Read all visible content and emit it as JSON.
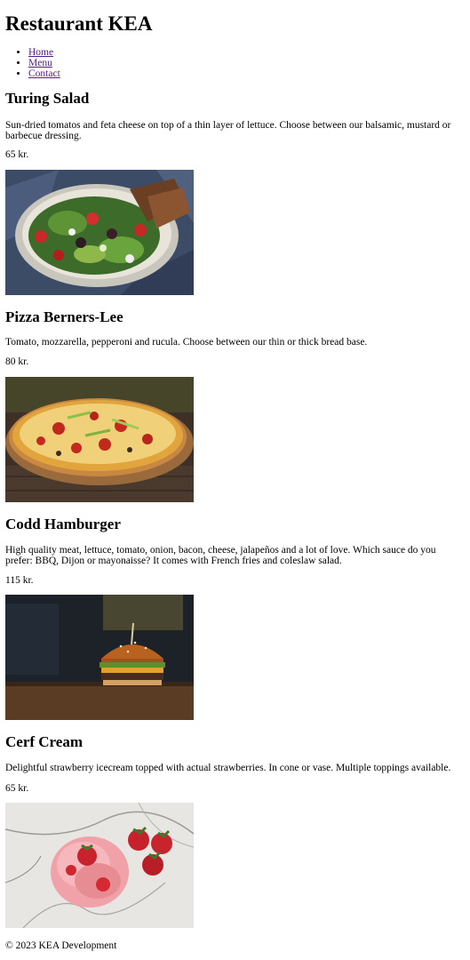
{
  "header": {
    "title": "Restaurant KEA"
  },
  "nav": {
    "items": [
      {
        "label": "Home"
      },
      {
        "label": "Menu"
      },
      {
        "label": "Contact"
      }
    ]
  },
  "menu": {
    "items": [
      {
        "name": "Turing Salad",
        "description": "Sun-dried tomatos and feta cheese on top of a thin layer of lettuce. Choose between our balsamic, mustard or barbecue dressing.",
        "price": "65 kr."
      },
      {
        "name": "Pizza Berners-Lee",
        "description": "Tomato, mozzarella, pepperoni and rucula. Choose between our thin or thick bread base.",
        "price": "80 kr."
      },
      {
        "name": "Codd Hamburger",
        "description": "High quality meat, lettuce, tomato, onion, bacon, cheese, jalapeños and a lot of love. Which sauce do you prefer: BBQ, Dijon or mayonaisse? It comes with French fries and coleslaw salad.",
        "price": "115 kr."
      },
      {
        "name": "Cerf Cream",
        "description": "Delightful strawberry icecream topped with actual strawberries. In cone or vase. Multiple toppings available.",
        "price": "65 kr."
      }
    ]
  },
  "footer": {
    "text": "© 2023 KEA Development"
  },
  "colors": {
    "link": "#551a8b",
    "text": "#000000",
    "background": "#ffffff"
  }
}
